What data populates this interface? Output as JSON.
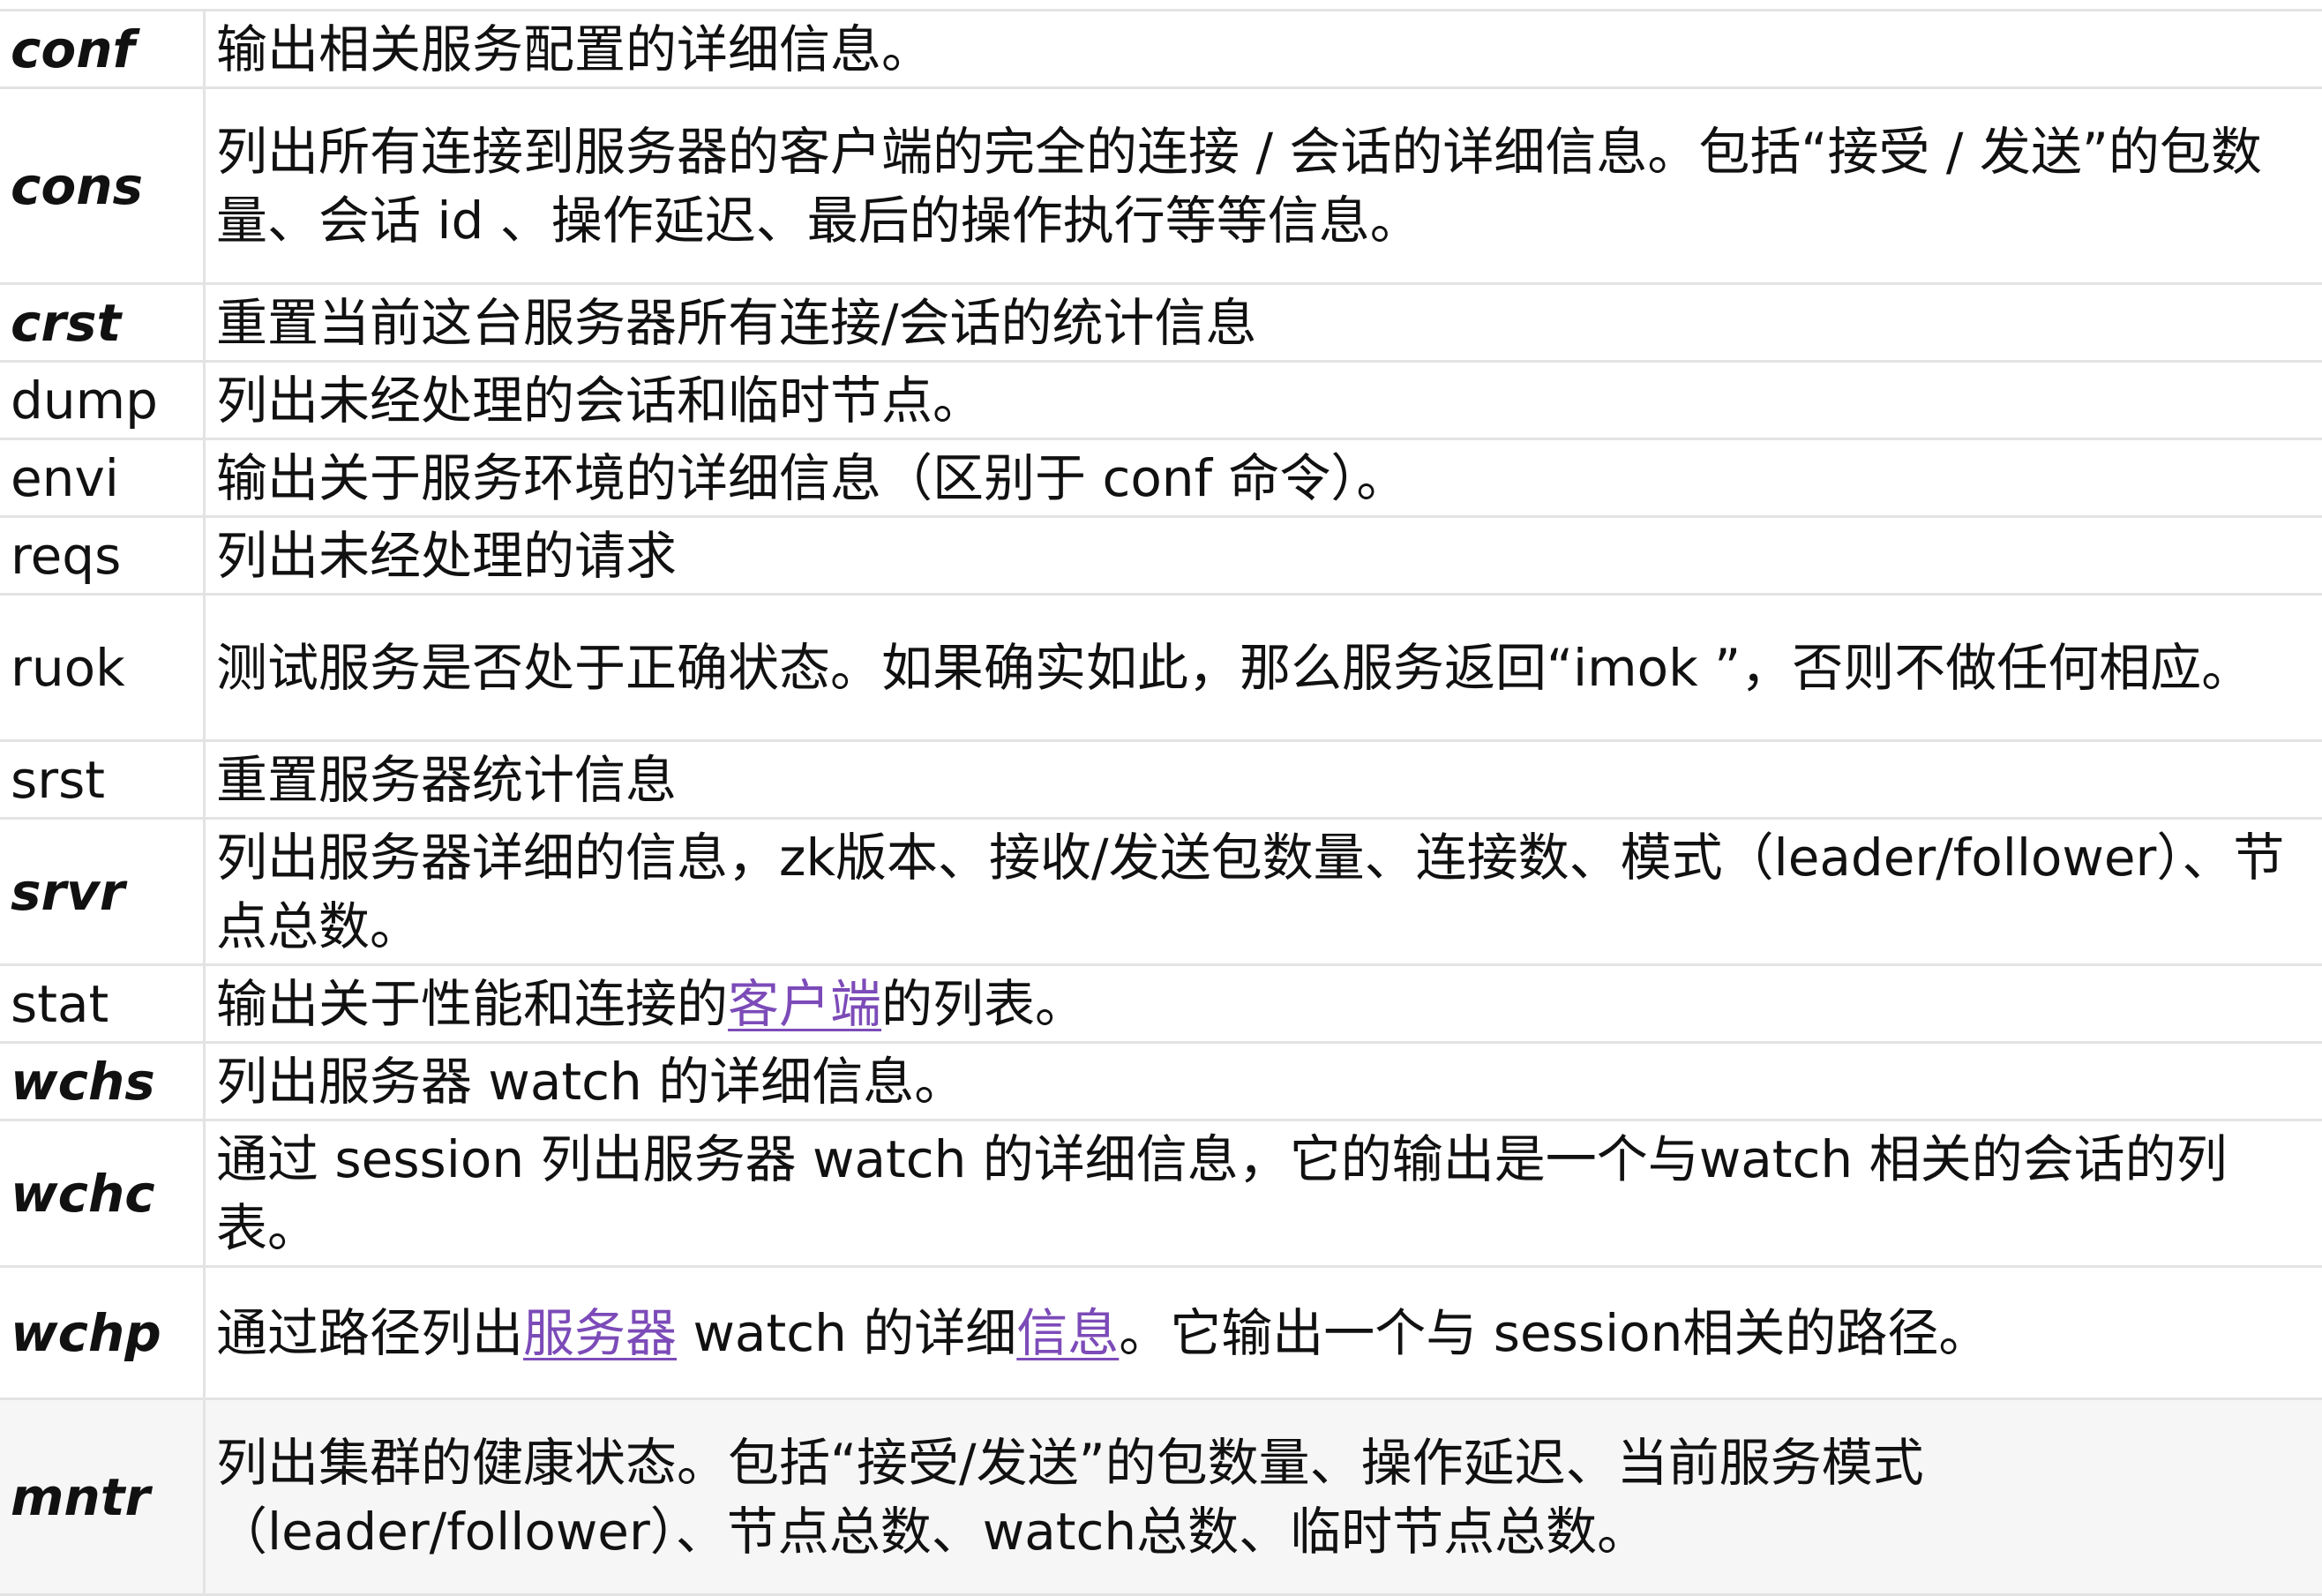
{
  "rows": [
    {
      "cmd": "conf",
      "desc": "输出相关服务配置的详细信息。"
    },
    {
      "cmd": "cons",
      "desc": "列出所有连接到服务器的客户端的完全的连接 / 会话的详细信息。包括“接受 / 发送”的包数量、会话 id 、操作延迟、最后的操作执行等等信息。"
    },
    {
      "cmd": "crst",
      "desc": "重置当前这台服务器所有连接/会话的统计信息"
    },
    {
      "cmd": "dump",
      "desc": "列出未经处理的会话和临时节点。"
    },
    {
      "cmd": "envi",
      "desc": "输出关于服务环境的详细信息（区别于 conf 命令）。"
    },
    {
      "cmd": "reqs",
      "desc": "列出未经处理的请求"
    },
    {
      "cmd": "ruok",
      "desc": "测试服务是否处于正确状态。如果确实如此，那么服务返回“imok ”，否则不做任何相应。"
    },
    {
      "cmd": "srst",
      "desc": "重置服务器统计信息"
    },
    {
      "cmd": "srvr",
      "desc": "列出服务器详细的信息，zk版本、接收/发送包数量、连接数、模式（leader/follower）、节点总数。"
    },
    {
      "cmd": "stat",
      "desc_a": "输出关于性能和连接的",
      "desc_link": "客户端",
      "desc_b": "的列表。"
    },
    {
      "cmd": "wchs",
      "desc": "列出服务器 watch 的详细信息。"
    },
    {
      "cmd": "wchc",
      "desc": "通过 session 列出服务器 watch 的详细信息，它的输出是一个与watch 相关的会话的列表。"
    },
    {
      "cmd": "wchp",
      "desc_a": "通过路径列出",
      "desc_link1": "服务器",
      "desc_b": " watch 的详细",
      "desc_link2": "信息",
      "desc_c": "。它输出一个与 session相关的路径。"
    },
    {
      "cmd": "mntr",
      "desc": "列出集群的健康状态。包括“接受/发送”的包数量、操作延迟、当前服务模式（leader/follower）、节点总数、watch总数、临时节点总数。"
    }
  ]
}
